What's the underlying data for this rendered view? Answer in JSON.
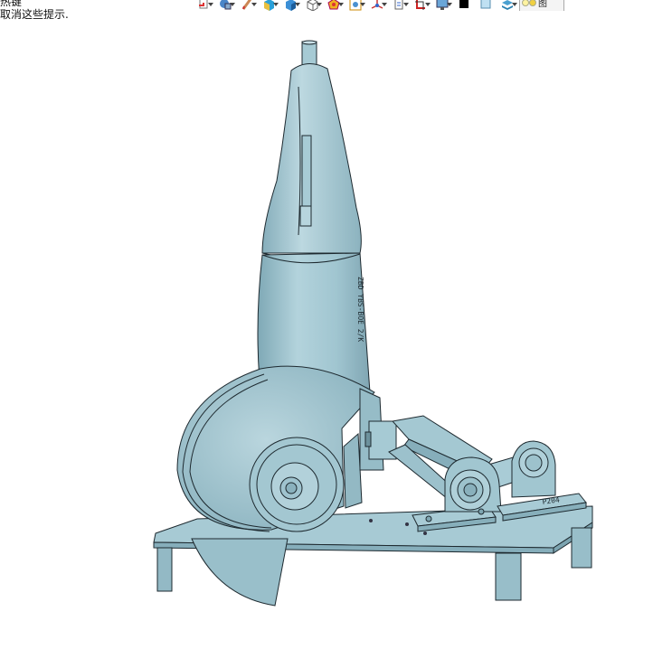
{
  "hints": {
    "line1": "热键",
    "line2": "取消这些提示."
  },
  "toolbar": {
    "buttons": [
      {
        "icon": "document-export-icon",
        "has_dropdown": true
      },
      {
        "icon": "render-style-icon",
        "has_dropdown": true
      },
      {
        "icon": "pencil-icon",
        "has_dropdown": true
      },
      {
        "icon": "solid-box-icon",
        "has_dropdown": true
      },
      {
        "icon": "shaded-cube-icon",
        "has_dropdown": true
      },
      {
        "icon": "wireframe-cube-icon",
        "has_dropdown": true
      },
      {
        "icon": "color-wheel-icon",
        "has_dropdown": true
      },
      {
        "icon": "image-frame-icon",
        "has_dropdown": true
      },
      {
        "icon": "axis-triad-icon",
        "has_dropdown": true
      },
      {
        "icon": "page-icon",
        "has_dropdown": true
      },
      {
        "icon": "crop-frame-icon",
        "has_dropdown": true
      },
      {
        "icon": "monitor-icon",
        "has_dropdown": true
      },
      {
        "icon": "black-square-icon",
        "has_dropdown": false
      },
      {
        "icon": "light-panel-icon",
        "has_dropdown": false
      },
      {
        "icon": "layers-icon",
        "has_dropdown": true
      }
    ],
    "last_label": "图"
  },
  "model": {
    "body_color": "#9fc4cf",
    "edge_color": "#1e2a30",
    "labels": {
      "motor_text": "ZBD YBS-BOE 2/K",
      "bearing_text": "P204"
    }
  }
}
